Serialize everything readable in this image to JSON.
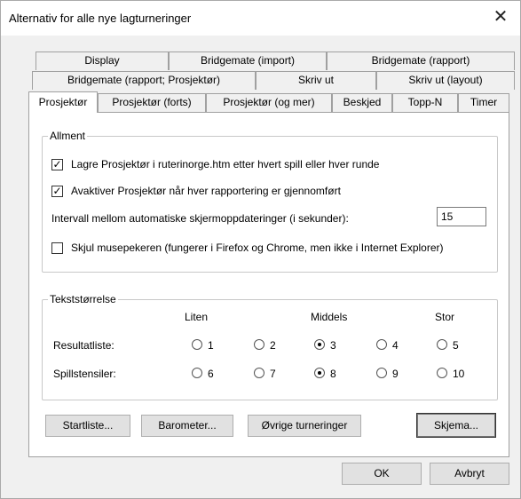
{
  "window": {
    "title": "Alternativ for alle nye lagturneringer",
    "close_glyph": "✕"
  },
  "tabs": {
    "row1": [
      "Display",
      "Bridgemate (import)",
      "Bridgemate (rapport)"
    ],
    "row2": [
      "Bridgemate (rapport; Prosjektør)",
      "Skriv ut",
      "Skriv ut (layout)"
    ],
    "row3": [
      "Prosjektør",
      "Prosjektør (forts)",
      "Prosjektør (og mer)",
      "Beskjed",
      "Topp-N",
      "Timer"
    ],
    "active": "Prosjektør"
  },
  "allment": {
    "legend": "Allment",
    "lagre": {
      "label": "Lagre Prosjektør i ruterinorge.htm etter hvert spill eller hver runde",
      "checked": true
    },
    "avaktiver": {
      "label": "Avaktiver Prosjektør når hver rapportering er gjennomført",
      "checked": true
    },
    "intervall": {
      "label": "Intervall mellom automatiske skjermoppdateringer (i sekunder):",
      "value": "15"
    },
    "skjul": {
      "label": "Skjul musepekeren (fungerer i Firefox og Chrome, men ikke i Internet Explorer)",
      "checked": false
    }
  },
  "tekst": {
    "legend": "Tekststørrelse",
    "headers": [
      "Liten",
      "Middels",
      "Stor"
    ],
    "resultat": {
      "label": "Resultatliste:",
      "options": [
        "1",
        "2",
        "3",
        "4",
        "5"
      ],
      "selected": "3"
    },
    "spill": {
      "label": "Spillstensiler:",
      "options": [
        "6",
        "7",
        "8",
        "9",
        "10"
      ],
      "selected": "8"
    }
  },
  "buttons": {
    "startliste": "Startliste...",
    "barometer": "Barometer...",
    "ovrige": "Øvrige turneringer",
    "skjema": "Skjema...",
    "ok": "OK",
    "avbryt": "Avbryt"
  },
  "check_glyph": "✓"
}
